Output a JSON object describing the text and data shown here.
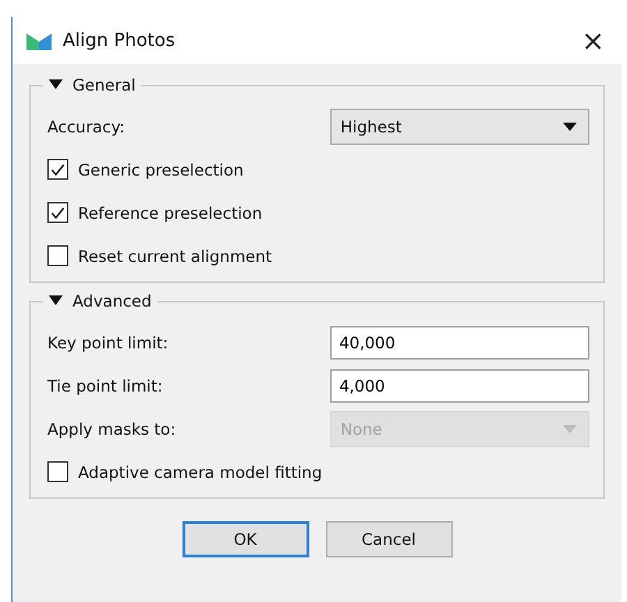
{
  "window": {
    "title": "Align Photos",
    "close": "×"
  },
  "groups": [
    {
      "title": "General",
      "expanded": true,
      "rows": [
        {
          "kind": "combo",
          "label": "Accuracy:",
          "value": "Highest",
          "disabled": false
        },
        {
          "kind": "checkbox",
          "label": "Generic preselection",
          "checked": true
        },
        {
          "kind": "checkbox",
          "label": "Reference preselection",
          "checked": true
        },
        {
          "kind": "checkbox",
          "label": "Reset current alignment",
          "checked": false
        }
      ]
    },
    {
      "title": "Advanced",
      "expanded": true,
      "rows": [
        {
          "kind": "input",
          "label": "Key point limit:",
          "value": "40,000"
        },
        {
          "kind": "input",
          "label": "Tie point limit:",
          "value": "4,000"
        },
        {
          "kind": "combo",
          "label": "Apply masks to:",
          "value": "None",
          "disabled": true
        },
        {
          "kind": "checkbox",
          "label": "Adaptive camera model fitting",
          "checked": false
        }
      ]
    }
  ],
  "buttons": [
    {
      "label": "OK",
      "default": true
    },
    {
      "label": "Cancel",
      "default": false
    }
  ]
}
